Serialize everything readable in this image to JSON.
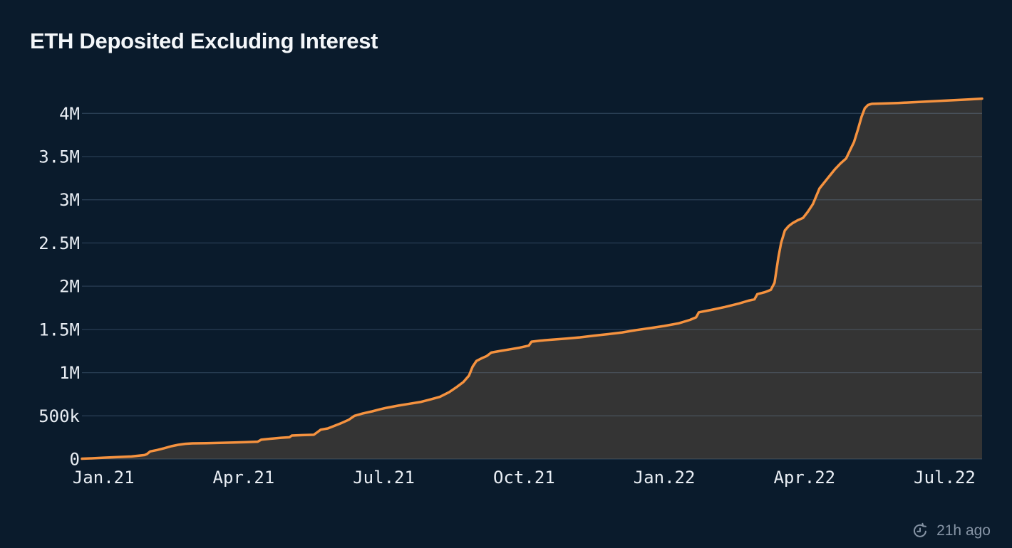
{
  "chart_data": {
    "type": "area",
    "title": "ETH Deposited Excluding Interest",
    "legend": "none",
    "grid": "horizontal",
    "x_unit": "months since Jan 2021",
    "x_range": [
      -0.46,
      18.8
    ],
    "y_range": [
      0,
      4200000
    ],
    "x_ticks": [
      {
        "t": 0,
        "label": "Jan.21"
      },
      {
        "t": 3,
        "label": "Apr.21"
      },
      {
        "t": 6,
        "label": "Jul.21"
      },
      {
        "t": 9,
        "label": "Oct.21"
      },
      {
        "t": 12,
        "label": "Jan.22"
      },
      {
        "t": 15,
        "label": "Apr.22"
      },
      {
        "t": 18,
        "label": "Jul.22"
      }
    ],
    "y_ticks": [
      {
        "v": 0,
        "label": "0"
      },
      {
        "v": 500000,
        "label": "500k"
      },
      {
        "v": 1000000,
        "label": "1M"
      },
      {
        "v": 1500000,
        "label": "1.5M"
      },
      {
        "v": 2000000,
        "label": "2M"
      },
      {
        "v": 2500000,
        "label": "2.5M"
      },
      {
        "v": 3000000,
        "label": "3M"
      },
      {
        "v": 3500000,
        "label": "3.5M"
      },
      {
        "v": 4000000,
        "label": "4M"
      }
    ],
    "series": [
      {
        "name": "ETH Deposited Excluding Interest",
        "points": [
          [
            -0.46,
            4000
          ],
          [
            -0.25,
            8000
          ],
          [
            0,
            16000
          ],
          [
            0.3,
            22000
          ],
          [
            0.6,
            30000
          ],
          [
            0.88,
            46000
          ],
          [
            0.93,
            58000
          ],
          [
            1.0,
            88000
          ],
          [
            1.15,
            105000
          ],
          [
            1.3,
            125000
          ],
          [
            1.45,
            148000
          ],
          [
            1.6,
            165000
          ],
          [
            1.75,
            176000
          ],
          [
            1.9,
            181000
          ],
          [
            2.2,
            184000
          ],
          [
            2.5,
            188000
          ],
          [
            2.8,
            192000
          ],
          [
            3.05,
            196000
          ],
          [
            3.3,
            201000
          ],
          [
            3.38,
            225000
          ],
          [
            3.55,
            234000
          ],
          [
            3.8,
            246000
          ],
          [
            3.98,
            252000
          ],
          [
            4.03,
            272000
          ],
          [
            4.25,
            277000
          ],
          [
            4.5,
            281000
          ],
          [
            4.57,
            308000
          ],
          [
            4.65,
            340000
          ],
          [
            4.8,
            354000
          ],
          [
            4.95,
            386000
          ],
          [
            5.1,
            418000
          ],
          [
            5.25,
            455000
          ],
          [
            5.37,
            500000
          ],
          [
            5.55,
            528000
          ],
          [
            5.75,
            552000
          ],
          [
            5.92,
            576000
          ],
          [
            6.05,
            592000
          ],
          [
            6.3,
            618000
          ],
          [
            6.55,
            640000
          ],
          [
            6.8,
            662000
          ],
          [
            7.0,
            690000
          ],
          [
            7.2,
            720000
          ],
          [
            7.4,
            775000
          ],
          [
            7.55,
            830000
          ],
          [
            7.7,
            890000
          ],
          [
            7.82,
            965000
          ],
          [
            7.9,
            1070000
          ],
          [
            7.98,
            1135000
          ],
          [
            8.1,
            1168000
          ],
          [
            8.2,
            1192000
          ],
          [
            8.3,
            1232000
          ],
          [
            8.5,
            1252000
          ],
          [
            8.7,
            1270000
          ],
          [
            8.9,
            1288000
          ],
          [
            9.0,
            1300000
          ],
          [
            9.1,
            1312000
          ],
          [
            9.16,
            1358000
          ],
          [
            9.35,
            1370000
          ],
          [
            9.6,
            1382000
          ],
          [
            9.9,
            1394000
          ],
          [
            10.2,
            1408000
          ],
          [
            10.5,
            1428000
          ],
          [
            10.8,
            1445000
          ],
          [
            11.1,
            1465000
          ],
          [
            11.4,
            1492000
          ],
          [
            11.7,
            1515000
          ],
          [
            12.0,
            1540000
          ],
          [
            12.3,
            1570000
          ],
          [
            12.55,
            1610000
          ],
          [
            12.68,
            1640000
          ],
          [
            12.74,
            1698000
          ],
          [
            13.0,
            1725000
          ],
          [
            13.3,
            1760000
          ],
          [
            13.6,
            1800000
          ],
          [
            13.8,
            1832000
          ],
          [
            13.93,
            1848000
          ],
          [
            13.99,
            1908000
          ],
          [
            14.15,
            1930000
          ],
          [
            14.28,
            1958000
          ],
          [
            14.36,
            2040000
          ],
          [
            14.44,
            2330000
          ],
          [
            14.5,
            2500000
          ],
          [
            14.58,
            2645000
          ],
          [
            14.66,
            2695000
          ],
          [
            14.74,
            2728000
          ],
          [
            14.85,
            2762000
          ],
          [
            14.97,
            2790000
          ],
          [
            15.07,
            2860000
          ],
          [
            15.18,
            2950000
          ],
          [
            15.32,
            3130000
          ],
          [
            15.5,
            3252000
          ],
          [
            15.65,
            3352000
          ],
          [
            15.77,
            3420000
          ],
          [
            15.89,
            3478000
          ],
          [
            15.99,
            3590000
          ],
          [
            16.06,
            3668000
          ],
          [
            16.14,
            3808000
          ],
          [
            16.22,
            3958000
          ],
          [
            16.29,
            4058000
          ],
          [
            16.36,
            4098000
          ],
          [
            16.44,
            4110000
          ],
          [
            16.7,
            4114000
          ],
          [
            17.0,
            4120000
          ],
          [
            17.3,
            4128000
          ],
          [
            17.6,
            4137000
          ],
          [
            17.9,
            4145000
          ],
          [
            18.2,
            4153000
          ],
          [
            18.5,
            4161000
          ],
          [
            18.8,
            4170000
          ]
        ]
      }
    ],
    "colors": {
      "background": "#0a1b2c",
      "line": "#f5923f",
      "area_fill": "#343434",
      "gridline": "rgba(130,165,200,0.25)",
      "axis_text": "#e9eef4",
      "title_text": "#f4f7fa",
      "footer_text": "#8694a5"
    }
  },
  "footer": {
    "updated_label": "21h ago",
    "icon": "history-clock-icon"
  }
}
